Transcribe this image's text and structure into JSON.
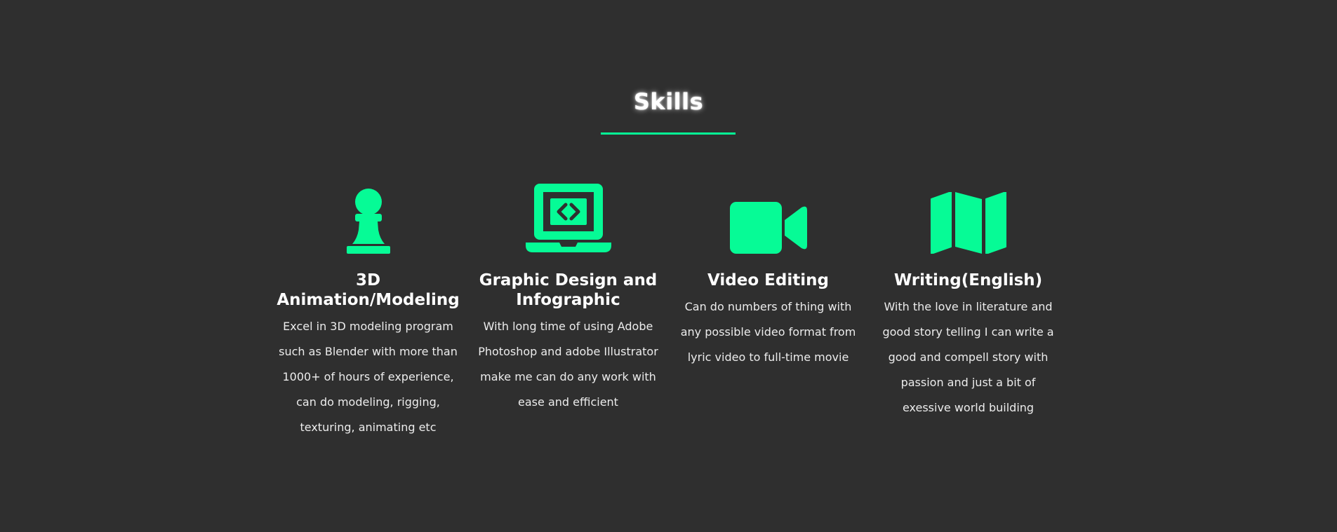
{
  "section": {
    "title": "Skills"
  },
  "theme": {
    "background": "#2f2f2f",
    "accent": "#06fb96",
    "text": "#ffffff"
  },
  "skills": [
    {
      "icon": "chess-pawn-icon",
      "title": "3D Animation/Modeling",
      "description": "Excel in 3D modeling program such as Blender with more than 1000+ of hours of experience, can do modeling, rigging, texturing, animating etc"
    },
    {
      "icon": "laptop-code-icon",
      "title": "Graphic Design and Infographic",
      "description": "With long time of using Adobe Photoshop and adobe Illustrator make me can do any work with ease and efficient"
    },
    {
      "icon": "video-camera-icon",
      "title": "Video Editing",
      "description": "Can do numbers of thing with any possible video format from lyric video to full-time movie"
    },
    {
      "icon": "map-icon",
      "title": "Writing(English)",
      "description": "With the love in literature and good story telling I can write a good and compell story with passion and just a bit of exessive world building"
    }
  ]
}
